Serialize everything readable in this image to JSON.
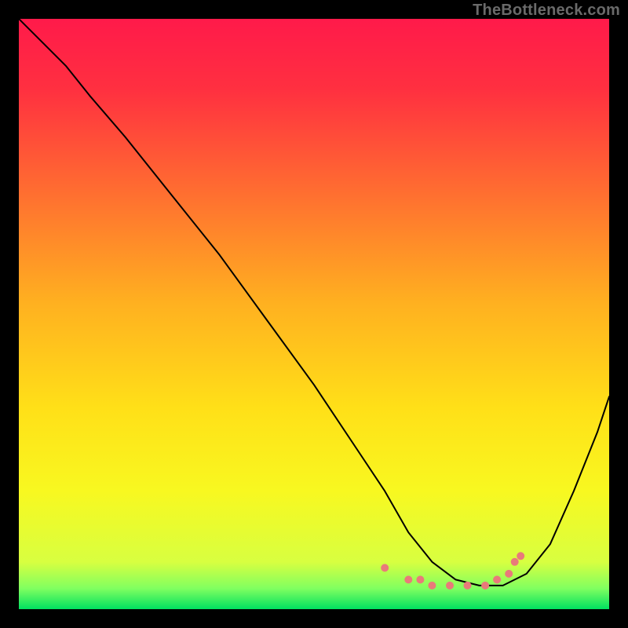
{
  "attribution": "TheBottleneck.com",
  "colors": {
    "gradient": [
      {
        "offset": 0.0,
        "color": "#ff1a4a"
      },
      {
        "offset": 0.12,
        "color": "#ff3040"
      },
      {
        "offset": 0.3,
        "color": "#ff7030"
      },
      {
        "offset": 0.48,
        "color": "#ffb020"
      },
      {
        "offset": 0.66,
        "color": "#ffe018"
      },
      {
        "offset": 0.8,
        "color": "#f8f820"
      },
      {
        "offset": 0.92,
        "color": "#d8ff40"
      },
      {
        "offset": 0.965,
        "color": "#80ff60"
      },
      {
        "offset": 1.0,
        "color": "#00e060"
      }
    ],
    "marker": "#e97a7a",
    "curve": "#000000"
  },
  "chart_data": {
    "type": "line",
    "title": "",
    "xlabel": "",
    "ylabel": "",
    "xlim": [
      0,
      100
    ],
    "ylim": [
      0,
      100
    ],
    "series": [
      {
        "name": "bottleneck-curve",
        "x": [
          0,
          4,
          8,
          12,
          18,
          26,
          34,
          42,
          50,
          58,
          62,
          66,
          70,
          74,
          78,
          82,
          86,
          90,
          94,
          98,
          100
        ],
        "y": [
          100,
          96,
          92,
          87,
          80,
          70,
          60,
          49,
          38,
          26,
          20,
          13,
          8,
          5,
          4,
          4,
          6,
          11,
          20,
          30,
          36
        ]
      }
    ],
    "markers": {
      "series": "bottleneck-curve",
      "color": "#e97a7a",
      "points": [
        {
          "x": 62,
          "y": 7
        },
        {
          "x": 66,
          "y": 5
        },
        {
          "x": 68,
          "y": 5
        },
        {
          "x": 70,
          "y": 4
        },
        {
          "x": 73,
          "y": 4
        },
        {
          "x": 76,
          "y": 4
        },
        {
          "x": 79,
          "y": 4
        },
        {
          "x": 81,
          "y": 5
        },
        {
          "x": 83,
          "y": 6
        },
        {
          "x": 84,
          "y": 8
        },
        {
          "x": 85,
          "y": 9
        }
      ],
      "radius": 5
    }
  }
}
